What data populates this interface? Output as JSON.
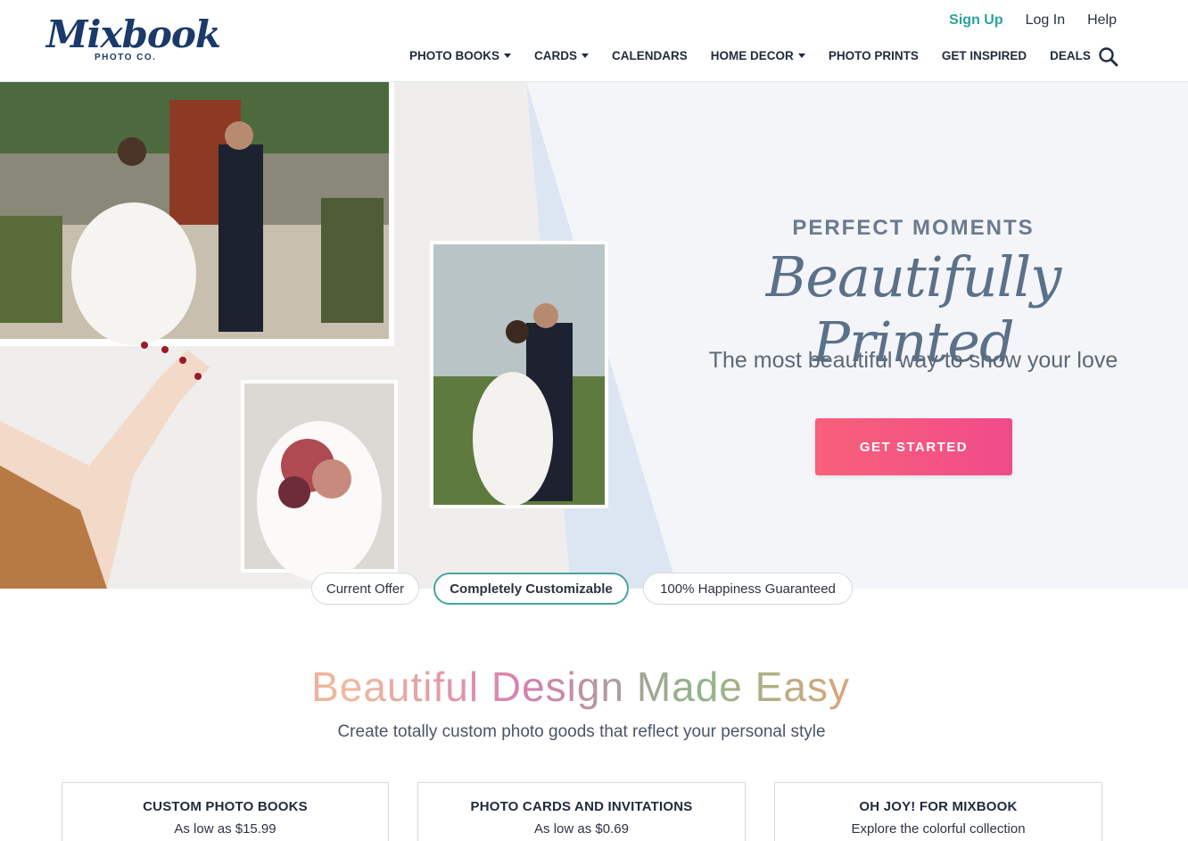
{
  "brand": {
    "name": "Mixbook",
    "tagline": "PHOTO CO."
  },
  "top_links": {
    "signup": "Sign Up",
    "login": "Log In",
    "help": "Help"
  },
  "nav": [
    {
      "label": "PHOTO BOOKS",
      "has_dropdown": true
    },
    {
      "label": "CARDS",
      "has_dropdown": true
    },
    {
      "label": "CALENDARS",
      "has_dropdown": false
    },
    {
      "label": "HOME DECOR",
      "has_dropdown": true
    },
    {
      "label": "PHOTO PRINTS",
      "has_dropdown": false
    },
    {
      "label": "GET INSPIRED",
      "has_dropdown": false
    },
    {
      "label": "DEALS",
      "has_dropdown": false
    }
  ],
  "search": {
    "icon": "search-icon"
  },
  "hero": {
    "eyebrow": "PERFECT MOMENTS",
    "script_title": "Beautifully Printed",
    "subtitle": "The most beautiful way to show your love",
    "cta": "GET STARTED"
  },
  "pills": [
    {
      "label": "Current Offer",
      "active": false
    },
    {
      "label": "Completely Customizable",
      "active": true
    },
    {
      "label": "100% Happiness Guaranteed",
      "active": false
    }
  ],
  "section": {
    "title": "Beautiful Design Made Easy",
    "subtitle": "Create totally custom photo goods that reflect your personal style"
  },
  "cards": [
    {
      "title": "CUSTOM PHOTO BOOKS",
      "subtitle": "As low as $15.99"
    },
    {
      "title": "PHOTO CARDS AND INVITATIONS",
      "subtitle": "As low as $0.69"
    },
    {
      "title": "OH JOY! FOR MIXBOOK",
      "subtitle": "Explore the colorful collection"
    }
  ],
  "colors": {
    "brand_navy": "#1b3a6b",
    "signup_teal": "#2aa39a",
    "cta_start": "#f9607a",
    "cta_end": "#ef4c8a",
    "active_pill_border": "#4aa39e",
    "hero_bg": "#f3f5f9"
  }
}
